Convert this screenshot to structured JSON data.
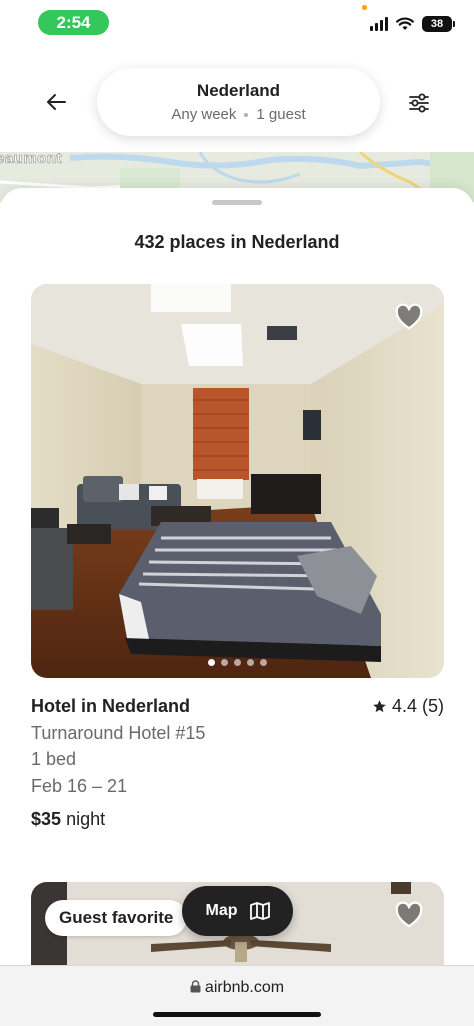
{
  "status": {
    "time": "2:54",
    "battery": "38"
  },
  "search": {
    "location": "Nederland",
    "when": "Any week",
    "guests": "1 guest"
  },
  "map": {
    "label": "eaumont"
  },
  "results": {
    "count_text": "432 places in Nederland"
  },
  "listings": [
    {
      "title": "Hotel in Nederland",
      "rating": "4.4 (5)",
      "name": "Turnaround Hotel #15",
      "beds": "1 bed",
      "dates": "Feb 16 – 21",
      "price_amount": "$35",
      "price_unit": "night",
      "photo_count": 5,
      "active_photo": 1
    },
    {
      "badge": "Guest favorite"
    }
  ],
  "map_button": {
    "label": "Map"
  },
  "browser": {
    "url": "airbnb.com"
  },
  "colors": {
    "status_green": "#34c759",
    "text_primary": "#222222",
    "text_secondary": "#6a6a6a"
  },
  "icons": [
    "back-arrow-icon",
    "filter-icon",
    "heart-icon",
    "star-icon",
    "map-icon",
    "lock-icon",
    "wifi-icon",
    "signal-icon"
  ]
}
